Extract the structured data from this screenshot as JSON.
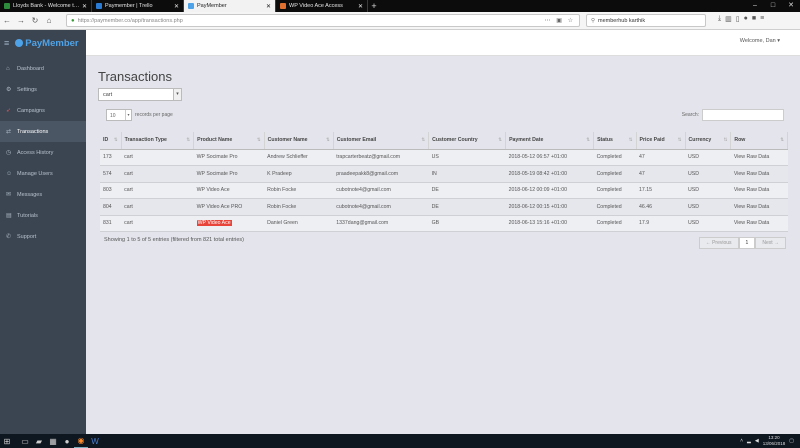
{
  "browser": {
    "tabs": [
      {
        "title": "Lloyds Bank - Welcome to Onl",
        "active": false,
        "color": "#2d8c3c"
      },
      {
        "title": "Paymember | Trello",
        "active": false,
        "color": "#2a7bd4"
      },
      {
        "title": "PayMember",
        "active": true,
        "color": "#4ea3e8"
      },
      {
        "title": "WP Video Ace Access",
        "active": false,
        "color": "#e07030"
      }
    ],
    "url": "https://paymember.co/app/transactions.php",
    "search_value": "memberhub karthik"
  },
  "app": {
    "logo": "PayMember",
    "welcome": "Welcome, Dan",
    "sidebar": [
      {
        "label": "Dashboard",
        "icon": "home-icon",
        "glyph": "⌂"
      },
      {
        "label": "Settings",
        "icon": "gear-icon",
        "glyph": "⚙"
      },
      {
        "label": "Campaigns",
        "icon": "rocket-icon",
        "glyph": "➶"
      },
      {
        "label": "Transactions",
        "icon": "cart-icon",
        "glyph": "⇄",
        "active": true
      },
      {
        "label": "Access History",
        "icon": "history-icon",
        "glyph": "◷"
      },
      {
        "label": "Manage Users",
        "icon": "users-icon",
        "glyph": "☺"
      },
      {
        "label": "Messages",
        "icon": "envelope-icon",
        "glyph": "✉"
      },
      {
        "label": "Tutorials",
        "icon": "book-icon",
        "glyph": "▤"
      },
      {
        "label": "Support",
        "icon": "support-icon",
        "glyph": "✆"
      }
    ]
  },
  "page": {
    "title": "Transactions",
    "filter_value": "cart",
    "per_page_value": "10",
    "per_page_label": "records per page",
    "search_label": "Search:",
    "columns": [
      "ID",
      "Transaction Type",
      "Product Name",
      "Customer Name",
      "Customer Email",
      "Customer Country",
      "Payment Date",
      "Status",
      "Price Paid",
      "Currency",
      "Row"
    ],
    "rows": [
      [
        "173",
        "cart",
        "WP Socimate Pro",
        "Andrew Schlieffer",
        "trapcarterbeatz@gmail.com",
        "US",
        "2018-05-12 06:57 +01:00",
        "Completed",
        "47",
        "USD",
        "View Raw Data"
      ],
      [
        "574",
        "cart",
        "WP Socimate Pro",
        "K Pradeep",
        "praadeepakk8@gmail.com",
        "IN",
        "2018-05-19 08:42 +01:00",
        "Completed",
        "47",
        "USD",
        "View Raw Data"
      ],
      [
        "803",
        "cart",
        "WP Video Ace",
        "Robin Focke",
        "cubotnote4@gmail.com",
        "DE",
        "2018-06-12 00:09 +01:00",
        "Completed",
        "17.15",
        "USD",
        "View Raw Data"
      ],
      [
        "804",
        "cart",
        "WP Video Ace PRO",
        "Robin Focke",
        "cubotnote4@gmail.com",
        "DE",
        "2018-06-12 00:15 +01:00",
        "Completed",
        "46.46",
        "USD",
        "View Raw Data"
      ],
      [
        "831",
        "cart",
        "WP Video Ace",
        "Daniel Green",
        "1337dang@gmail.com",
        "GB",
        "2018-06-13 15:16 +01:00",
        "Completed",
        "17.9",
        "USD",
        "View Raw Data"
      ]
    ],
    "highlighted_product": "WP Video Ace",
    "info": "Showing 1 to 5 of 5 entries (filtered from 821 total entries)",
    "pagination": {
      "prev": "← Previous",
      "current": "1",
      "next": "Next →"
    }
  },
  "taskbar": {
    "time": "13:20",
    "date": "13/06/2018"
  }
}
